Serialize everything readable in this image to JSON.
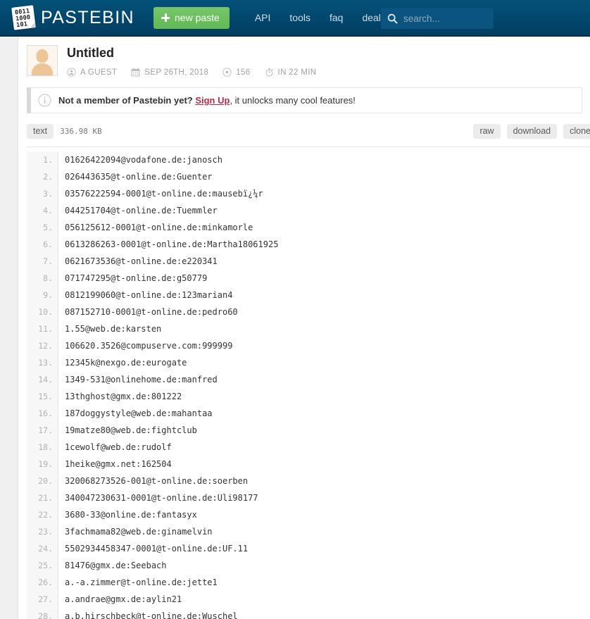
{
  "nav": {
    "brand": "PASTEBIN",
    "logo_bits": [
      "0011",
      "1000",
      "101"
    ],
    "new_paste_label": "new paste",
    "links": [
      {
        "label": "API"
      },
      {
        "label": "tools"
      },
      {
        "label": "faq"
      },
      {
        "label": "deals"
      }
    ],
    "search_placeholder": "search...",
    "search_value": "",
    "colors": {
      "bar": "#02456b",
      "button": "#6cbf5e",
      "search_bg": "#0b5480"
    }
  },
  "paste": {
    "title": "Untitled",
    "author": "A GUEST",
    "date": "SEP 26TH, 2018",
    "views": "156",
    "expires": "IN 22 MIN"
  },
  "alert": {
    "prefix": "Not a member of Pastebin yet? ",
    "link": "Sign Up",
    "suffix": ", it unlocks many cool features!",
    "link_color": "#c0284a"
  },
  "toolbar": {
    "format_label": "text",
    "filesize": "336.98 KB",
    "raw_label": "raw",
    "download_label": "download",
    "clone_label": "clone"
  },
  "code": {
    "lines": [
      "01626422094@vodafone.de:janosch",
      "026443635@t-online.de:Guenter",
      "03576222594-0001@t-online.de:mausebï¿¼r",
      "044251704@t-online.de:Tuemmler",
      "056125612-0001@t-online.de:minkamorle",
      "0613286263-0001@t-online.de:Martha18061925",
      "0621673536@t-online.de:e220341",
      "071747295@t-online.de:g50779",
      "0812199060@t-online.de:123marian4",
      "087152710-0001@t-online.de:pedro60",
      "1.55@web.de:karsten",
      "106620.3526@compuserve.com:999999",
      "12345k@nexgo.de:eurogate",
      "1349-531@onlinehome.de:manfred",
      "13thghost@gmx.de:801222",
      "187doggystyle@web.de:mahantaa",
      "19matze80@web.de:fightclub",
      "1cewolf@web.de:rudolf",
      "1heike@gmx.net:162504",
      "320068273526-001@t-online.de:soerben",
      "340047230631-0001@t-online.de:Uli98177",
      "3680-33@online.de:fantasyx",
      "3fachmama82@web.de:ginamelvin",
      "5502934458347-0001@t-online.de:UF.11",
      "81476@gmx.de:Seebach",
      "a.-a.zimmer@t-online.de:jette1",
      "a.andrae@gmx.de:aylin21",
      "a.b.hirschbeck@t-online.de:Wuschel"
    ]
  }
}
